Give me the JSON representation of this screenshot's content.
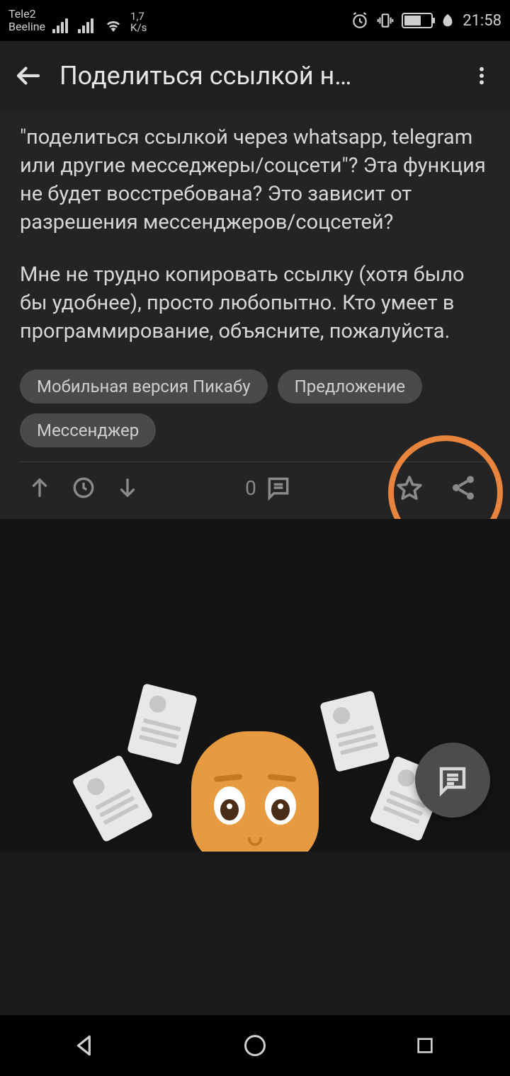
{
  "status": {
    "carrier1": "Tele2",
    "carrier2": "Beeline",
    "data_rate_num": "1,7",
    "data_rate_unit": "K/s",
    "battery": "60",
    "time": "21:58"
  },
  "header": {
    "title": "Поделиться ссылкой н…"
  },
  "post": {
    "para1": "\"поделиться ссылкой через whatsapp, telegram или другие месседжеры/соцсети\"? Эта функция не будет восстребована? Это зависит от разрешения мессенджеров/соцсетей?",
    "para2": "Мне не трудно копировать ссылку (хотя было бы удобнее), просто любопытно. Кто умеет в программирование, объясните, пожалуйста."
  },
  "tags": [
    "Мобильная версия Пикабу",
    "Предложение",
    "Мессенджер"
  ],
  "actions": {
    "comments_count": "0"
  }
}
